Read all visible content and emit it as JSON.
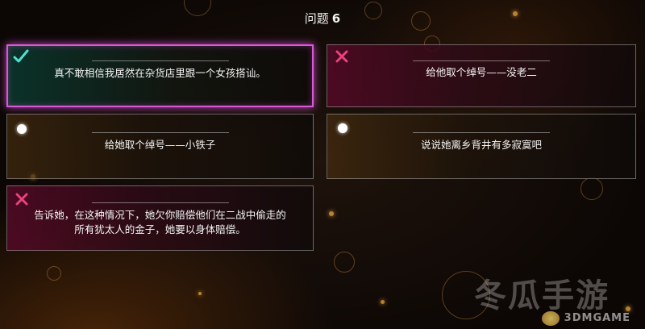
{
  "question": {
    "prefix": "问题",
    "number": "6"
  },
  "options": [
    {
      "id": "a",
      "text": "真不敢相信我居然在杂货店里跟一个女孩搭讪。",
      "status": "correct",
      "icon": "check-icon"
    },
    {
      "id": "b",
      "text": "给他取个绰号——没老二",
      "status": "wrong",
      "icon": "cross-icon"
    },
    {
      "id": "c",
      "text": "给她取个绰号——小铁子",
      "status": "neutral",
      "icon": "dot-icon"
    },
    {
      "id": "d",
      "text": "说说她离乡背井有多寂寞吧",
      "status": "neutral",
      "icon": "dot-icon"
    },
    {
      "id": "e",
      "text_line1": "告诉她，在这种情况下，她欠你赔偿他们在二战中偷走的",
      "text_line2": "所有犹太人的金子，她要以身体赔偿。",
      "status": "wrong",
      "icon": "cross-icon"
    }
  ],
  "colors": {
    "correct_border": "#d85bd6",
    "check": "#4fe0d0",
    "cross": "#e8437a",
    "neutral_dot": "#ffffff"
  },
  "watermark": {
    "brand": "冬瓜手游",
    "site": "3DMGAME"
  }
}
